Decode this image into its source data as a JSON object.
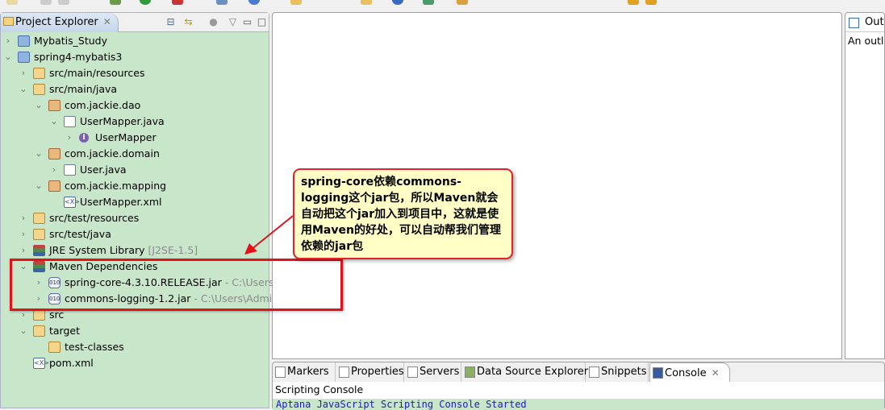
{
  "project_explorer": {
    "title": "Project Explorer",
    "close": "✕",
    "tree": [
      {
        "label": "Mybatis_Study",
        "icon": "project-icon",
        "chevron": "›"
      },
      {
        "label": "spring4-mybatis3",
        "icon": "maven-project-icon",
        "chevron": "⌄"
      },
      {
        "label": "src/main/resources",
        "icon": "source-folder-icon",
        "chevron": "›"
      },
      {
        "label": "src/main/java",
        "icon": "source-folder-icon",
        "chevron": "⌄"
      },
      {
        "label": "com.jackie.dao",
        "icon": "package-icon",
        "chevron": "⌄"
      },
      {
        "label": "UserMapper.java",
        "icon": "java-file-icon",
        "chevron": "⌄"
      },
      {
        "label": "UserMapper",
        "icon": "interface-icon",
        "chevron": "›"
      },
      {
        "label": "com.jackie.domain",
        "icon": "package-icon",
        "chevron": "⌄"
      },
      {
        "label": "User.java",
        "icon": "java-file-icon",
        "chevron": "›"
      },
      {
        "label": "com.jackie.mapping",
        "icon": "package-icon",
        "chevron": "⌄"
      },
      {
        "label": "UserMapper.xml",
        "icon": "xml-file-icon",
        "chevron": ""
      },
      {
        "label": "src/test/resources",
        "icon": "source-folder-icon",
        "chevron": "›"
      },
      {
        "label": "src/test/java",
        "icon": "source-folder-icon",
        "chevron": "›"
      },
      {
        "label": "JRE System Library",
        "suffix": "[J2SE-1.5]",
        "icon": "library-icon",
        "chevron": "›"
      },
      {
        "label": "Maven Dependencies",
        "icon": "library-icon",
        "chevron": "⌄"
      },
      {
        "label": "spring-core-4.3.10.RELEASE.jar",
        "suffix": "- C:\\Users\\A",
        "icon": "jar-icon",
        "chevron": "›"
      },
      {
        "label": "commons-logging-1.2.jar",
        "suffix": "- C:\\Users\\Admin",
        "icon": "jar-icon",
        "chevron": "›"
      },
      {
        "label": "src",
        "icon": "folder-icon",
        "chevron": "›"
      },
      {
        "label": "target",
        "icon": "folder-icon",
        "chevron": "⌄"
      },
      {
        "label": "test-classes",
        "icon": "folder-icon",
        "chevron": ""
      },
      {
        "label": "pom.xml",
        "icon": "xml-file-icon",
        "chevron": ""
      }
    ]
  },
  "outline": {
    "title": "Outli",
    "message": "An outlin"
  },
  "bottom": {
    "tabs": [
      "Markers",
      "Properties",
      "Servers",
      "Data Source Explorer",
      "Snippets",
      "Console"
    ],
    "close": "✕",
    "console_title": "Scripting Console",
    "console_output": "Aptana JavaScript Scripting Console Started"
  },
  "annotation": {
    "text": "spring-core依赖commons-logging这个jar包，所以Maven就会自动把这个jar加入到项目中，这就是使用Maven的好处，可以自动帮我们管理依赖的jar包"
  },
  "colors": {
    "tree_bg": "#c8e6c9",
    "annotation_border": "#e5222a",
    "annotation_bg": "#ffffc6"
  }
}
